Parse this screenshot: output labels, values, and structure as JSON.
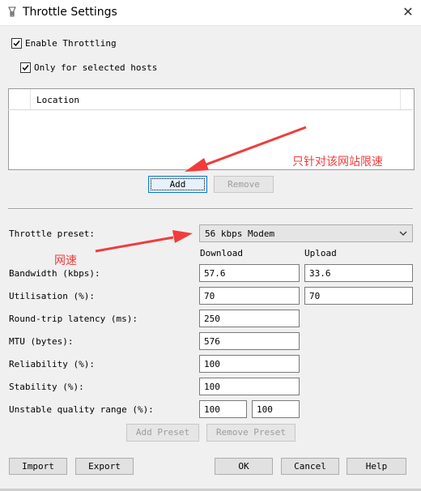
{
  "window": {
    "title": "Throttle Settings",
    "close_glyph": "✕",
    "icon": "app-icon"
  },
  "enable_throttling": {
    "label": "Enable Throttling",
    "checked": true
  },
  "only_selected_hosts": {
    "label": "Only for selected hosts",
    "checked": true
  },
  "hosts_table": {
    "columns": [
      "Location"
    ],
    "rows": []
  },
  "host_buttons": {
    "add": "Add",
    "remove": "Remove"
  },
  "annotations": {
    "host_note": "只针对该网站限速",
    "speed_note": "网速"
  },
  "preset": {
    "label": "Throttle preset:",
    "selected": "56 kbps Modem"
  },
  "columns": {
    "download": "Download",
    "upload": "Upload"
  },
  "fields": {
    "bandwidth": {
      "label": "Bandwidth (kbps):",
      "download": "57.6",
      "upload": "33.6"
    },
    "utilisation": {
      "label": "Utilisation (%):",
      "download": "70",
      "upload": "70"
    },
    "latency": {
      "label": "Round-trip latency (ms):",
      "value": "250"
    },
    "mtu": {
      "label": "MTU (bytes):",
      "value": "576"
    },
    "reliability": {
      "label": "Reliability (%):",
      "value": "100"
    },
    "stability": {
      "label": "Stability (%):",
      "value": "100"
    },
    "unstable_range": {
      "label": "Unstable quality range (%):",
      "min": "100",
      "max": "100"
    }
  },
  "preset_buttons": {
    "add": "Add Preset",
    "remove": "Remove Preset"
  },
  "footer_buttons": {
    "import": "Import",
    "export": "Export",
    "ok": "OK",
    "cancel": "Cancel",
    "help": "Help"
  },
  "colors": {
    "annotation": "#f03c3c",
    "focus": "#0078d7"
  }
}
